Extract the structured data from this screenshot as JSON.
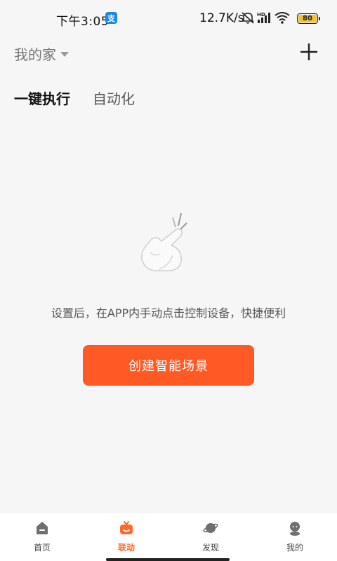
{
  "status_bar": {
    "time": "下午3:05",
    "app_icon_glyph": "支",
    "net_speed": "12.7K/s",
    "battery_level": "80",
    "icons": [
      "mute-icon",
      "hd-signal-icon",
      "wifi-icon",
      "battery-icon"
    ]
  },
  "header": {
    "home_name": "我的家",
    "add_icon": "plus-icon"
  },
  "tabs": [
    {
      "label": "一键执行",
      "active": true
    },
    {
      "label": "自动化",
      "active": false
    }
  ],
  "empty_state": {
    "icon": "tap-hand-icon",
    "description": "设置后，在APP内手动点击控制设备，快捷便利",
    "button_label": "创建智能场景"
  },
  "bottom_nav": [
    {
      "label": "首页",
      "icon": "home-icon",
      "active": false
    },
    {
      "label": "联动",
      "icon": "linkage-icon",
      "active": true
    },
    {
      "label": "发现",
      "icon": "planet-icon",
      "active": false
    },
    {
      "label": "我的",
      "icon": "profile-icon",
      "active": false
    }
  ],
  "colors": {
    "accent": "#ff5a26",
    "active_nav": "#ff6a2c",
    "background": "#f6f6f6"
  }
}
